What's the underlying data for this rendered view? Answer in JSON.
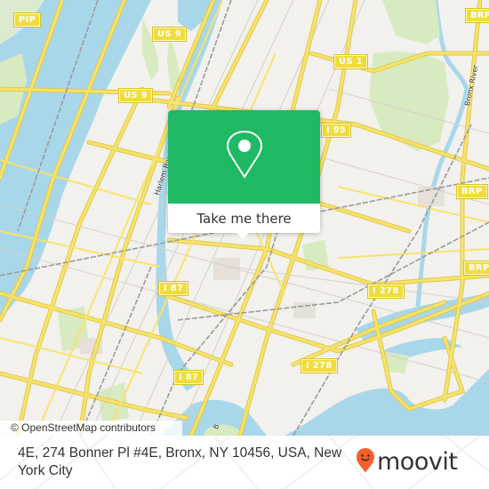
{
  "map": {
    "shields": [
      {
        "label": "PIP"
      },
      {
        "label": "US 9"
      },
      {
        "label": "US 9"
      },
      {
        "label": "US 1"
      },
      {
        "label": "I 95"
      },
      {
        "label": "BRP"
      },
      {
        "label": "BRP"
      },
      {
        "label": "BRP"
      },
      {
        "label": "I 87"
      },
      {
        "label": "I 87"
      },
      {
        "label": "I 278"
      },
      {
        "label": "I 278"
      }
    ],
    "labels": {
      "harlem_river": "Harlem River",
      "bronx_river": "Bronx River",
      "b_label": "B"
    },
    "attribution": "© OpenStreetMap contributors",
    "colors": {
      "water": "#a8d7ea",
      "land": "#f2f1ed",
      "park": "#d8eac0",
      "road": "#f7e36a",
      "road_casing": "#e0c84a",
      "rail": "#999999"
    }
  },
  "popup": {
    "icon": "map-pin-icon",
    "button_label": "Take me there",
    "accent_color": "#1fb865"
  },
  "footer": {
    "address": "4E, 274 Bonner Pl #4E, Bronx, NY 10456, USA, New York City",
    "logo_icon": "moovit-pin-icon",
    "logo_text": "moovit",
    "logo_color": "#f0612e"
  }
}
